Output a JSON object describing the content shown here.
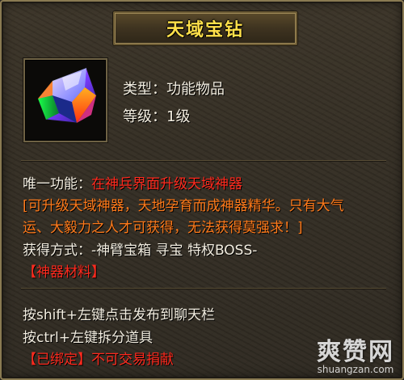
{
  "item": {
    "title": "天域宝钻",
    "type_line": "类型：功能物品",
    "level_line": "等级：1级",
    "icon": "gem-icon"
  },
  "description": {
    "func_label": "唯一功能：",
    "func_value": "在神兵界面升级天域神器",
    "lore_line1": "[可升级天域神器，天地孕育而成神器精华。只有大气",
    "lore_line2": "运、大毅力之人才可获得，无法获得莫强求！]",
    "source_line": "获得方式：-神臂宝箱 寻宝 特权BOSS-",
    "category_tag": "【神器材料】"
  },
  "hints": {
    "shift_line": "按shift+左键点击发布到聊天栏",
    "ctrl_line": "按ctrl+左键拆分道具",
    "bound_tag": "【已绑定】",
    "bound_value": "不可交易捐献"
  },
  "watermark": {
    "logo": "爽赞网",
    "url": "shuangzan.com"
  },
  "colors": {
    "title": "#ffe04a",
    "red": "#ff2a1e",
    "orange": "#ff7a1a",
    "text": "#f2ede0"
  }
}
